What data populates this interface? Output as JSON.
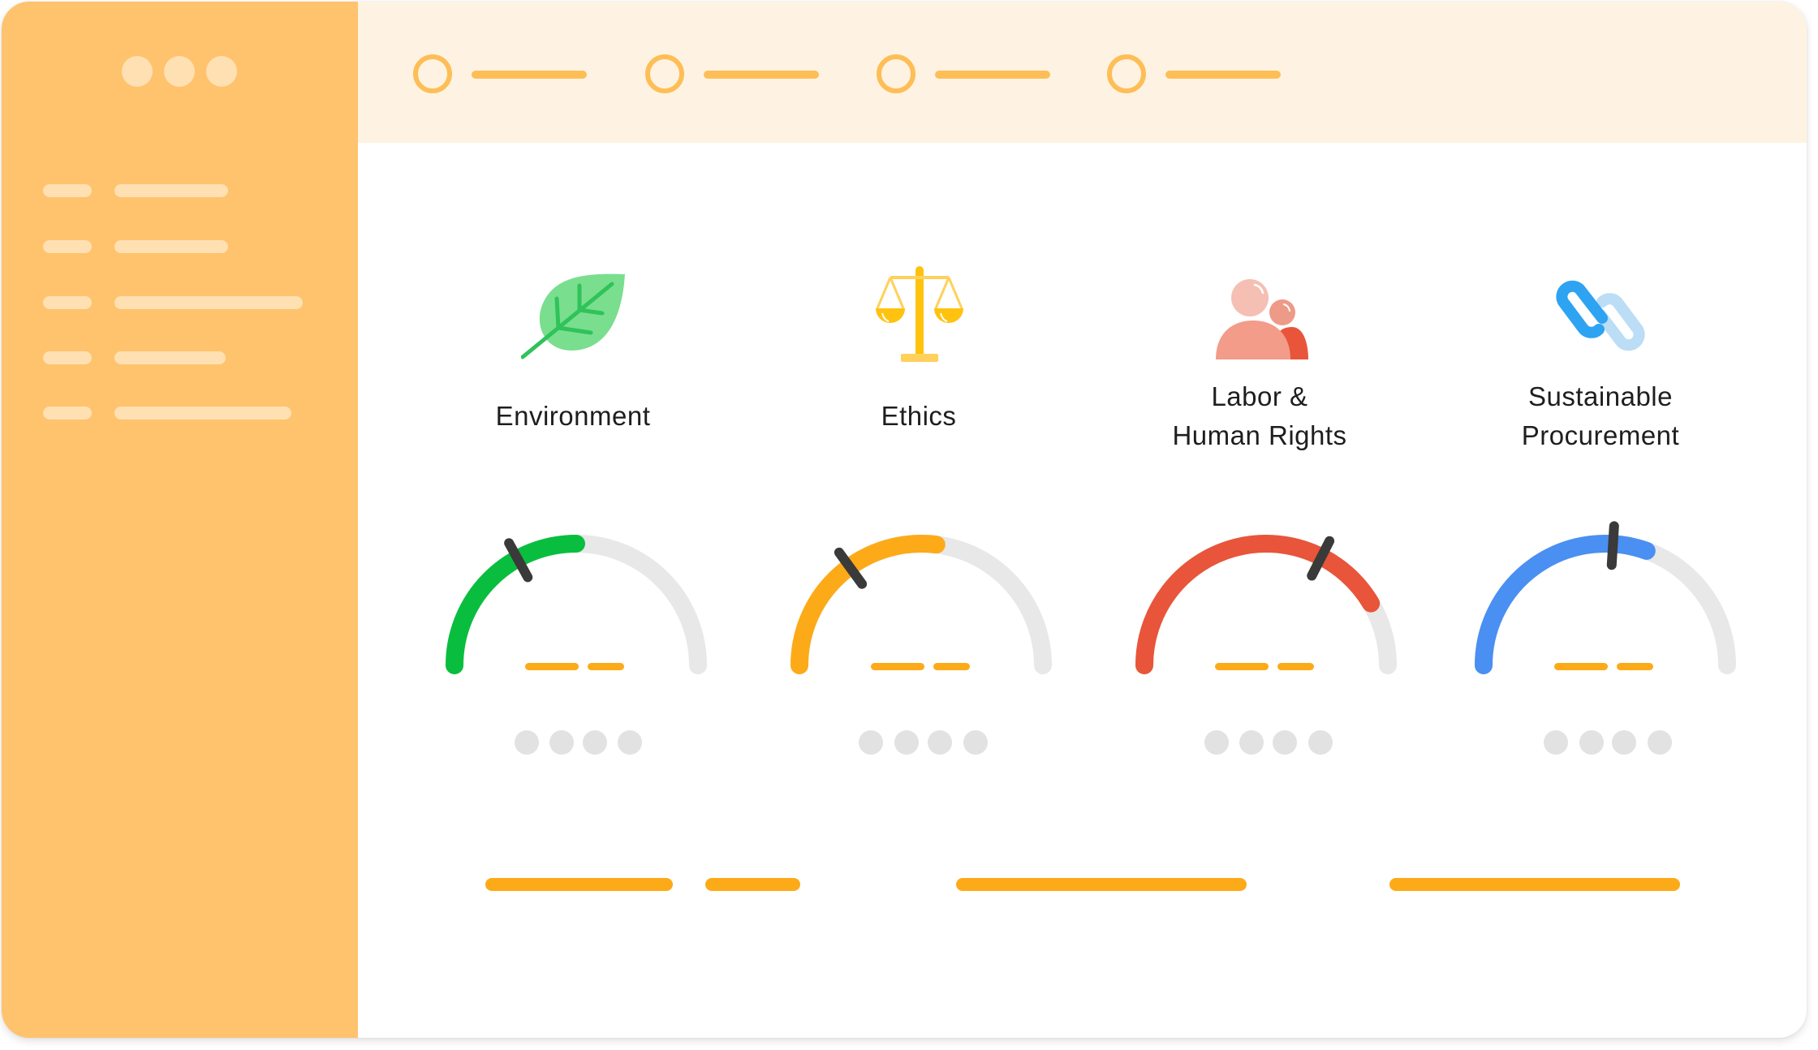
{
  "window": {
    "controls": [
      "dot",
      "dot",
      "dot"
    ]
  },
  "sidebar": {
    "items": [
      {
        "name": "sidebar-item-1",
        "long_fraction": 0.6
      },
      {
        "name": "sidebar-item-2",
        "long_fraction": 0.6
      },
      {
        "name": "sidebar-item-3",
        "long_fraction": 1.0
      },
      {
        "name": "sidebar-item-4",
        "long_fraction": 0.59
      },
      {
        "name": "sidebar-item-5",
        "long_fraction": 0.88
      }
    ]
  },
  "header": {
    "steps": [
      {
        "name": "step-1"
      },
      {
        "name": "step-2"
      },
      {
        "name": "step-3"
      },
      {
        "name": "step-4"
      }
    ]
  },
  "categories": [
    {
      "key": "environment",
      "label_lines": [
        "Environment"
      ],
      "icon": "leaf-icon",
      "color": "#09BE3E",
      "gauge_fill": 0.5,
      "needle": 0.34
    },
    {
      "key": "ethics",
      "label_lines": [
        "Ethics"
      ],
      "icon": "scales-icon",
      "color": "#FDAA19",
      "gauge_fill": 0.54,
      "needle": 0.3
    },
    {
      "key": "labor",
      "label_lines": [
        "Labor &",
        "Human Rights"
      ],
      "icon": "people-icon",
      "color": "#E8553A",
      "gauge_fill": 0.83,
      "needle": 0.65
    },
    {
      "key": "procurement",
      "label_lines": [
        "Sustainable",
        "Procurement"
      ],
      "icon": "chain-link-icon",
      "color": "#4A8FF2",
      "gauge_fill": 0.61,
      "needle": 0.52
    }
  ],
  "colors": {
    "sidebar": "#FEC36C",
    "header": "#FEF3E2",
    "accent": "#FDAA19",
    "track": "#E8E8E8",
    "needle": "#3A3A3A"
  }
}
